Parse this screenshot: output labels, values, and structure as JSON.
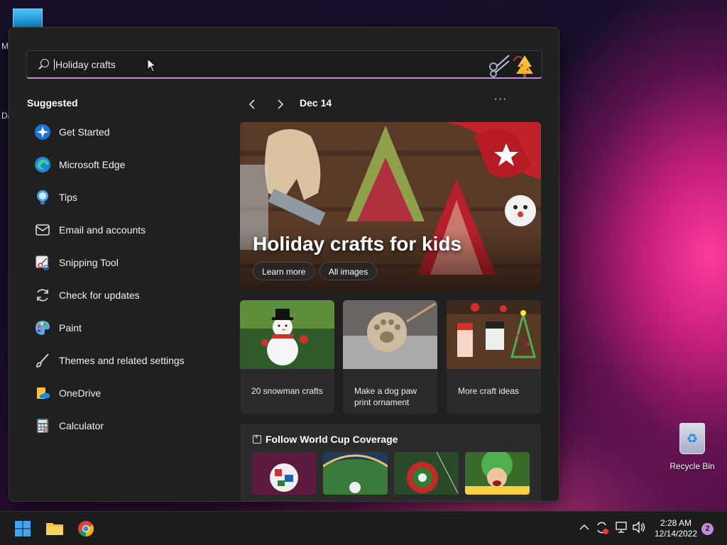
{
  "desktop": {
    "edge_texts": [
      "M",
      "Da"
    ],
    "recycle_bin_label": "Recycle Bin"
  },
  "search": {
    "value": "Holiday crafts"
  },
  "suggested": {
    "title": "Suggested",
    "items": [
      {
        "label": "Get Started",
        "icon": "get-started-icon"
      },
      {
        "label": "Microsoft Edge",
        "icon": "edge-icon"
      },
      {
        "label": "Tips",
        "icon": "tips-icon"
      },
      {
        "label": "Email and accounts",
        "icon": "mail-icon"
      },
      {
        "label": "Snipping Tool",
        "icon": "snipping-tool-icon"
      },
      {
        "label": "Check for updates",
        "icon": "refresh-icon"
      },
      {
        "label": "Paint",
        "icon": "paint-icon"
      },
      {
        "label": "Themes and related settings",
        "icon": "brush-icon"
      },
      {
        "label": "OneDrive",
        "icon": "onedrive-icon"
      },
      {
        "label": "Calculator",
        "icon": "calculator-icon"
      }
    ]
  },
  "feed": {
    "date": "Dec 14",
    "more": "···",
    "hero": {
      "title": "Holiday crafts for kids",
      "learn_more": "Learn more",
      "all_images": "All images"
    },
    "cards": [
      {
        "caption": "20 snowman crafts"
      },
      {
        "caption": "Make a dog paw print ornament"
      },
      {
        "caption": "More craft ideas"
      }
    ],
    "worldcup_title": "Follow World Cup Coverage"
  },
  "taskbar": {
    "time": "2:28 AM",
    "date": "12/14/2022",
    "notification_count": "2"
  },
  "colors": {
    "accent": "#c48ad8",
    "panel": "#202020",
    "card": "#2b2b2b"
  }
}
